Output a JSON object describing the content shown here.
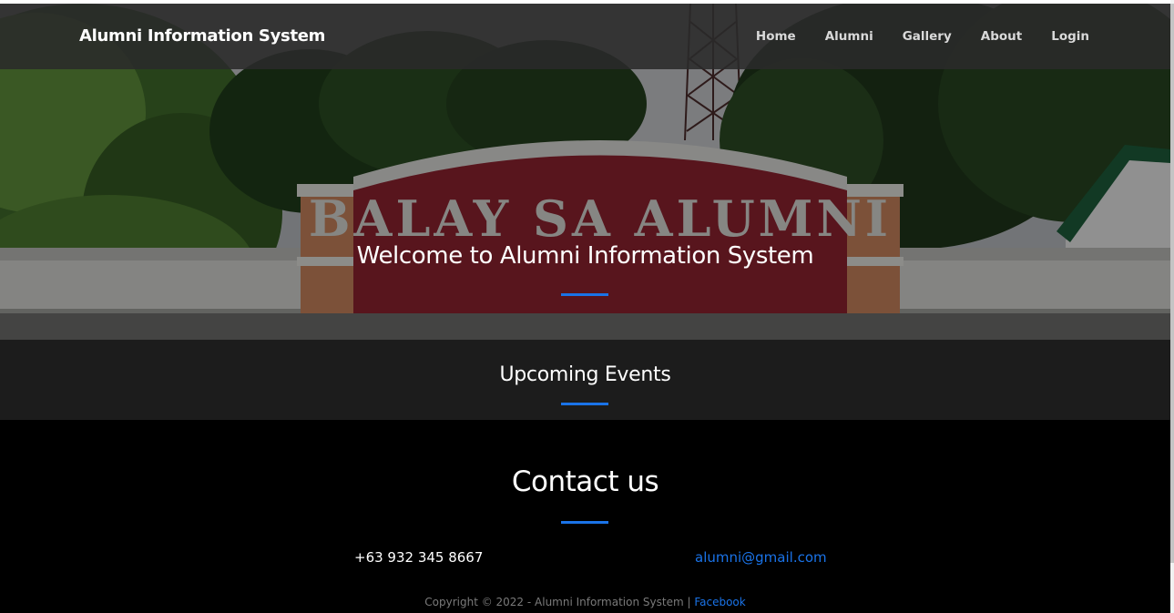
{
  "navbar": {
    "brand": "Alumni Information System",
    "links": [
      "Home",
      "Alumni",
      "Gallery",
      "About",
      "Login"
    ]
  },
  "hero": {
    "title": "Welcome to Alumni Information System",
    "sign_text": "BALAY SA ALUMNI"
  },
  "events": {
    "title": "Upcoming Events"
  },
  "contact": {
    "title": "Contact us",
    "phone": "+63 932 345 8667",
    "email": "alumni@gmail.com"
  },
  "footer": {
    "copyright": "Copyright © 2022 - Alumni Information System | ",
    "facebook": "Facebook"
  },
  "colors": {
    "accent": "#1a73e8",
    "navbar_bg": "#2a2a2a",
    "events_bg": "#1c1c1c",
    "contact_bg": "#000000"
  }
}
